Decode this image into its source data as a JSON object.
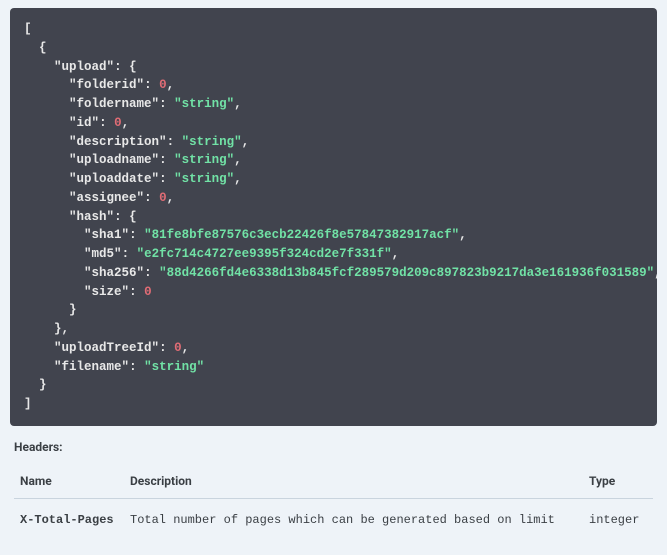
{
  "code": {
    "upload": {
      "folderid_key": "folderid",
      "folderid_val": "0",
      "foldername_key": "foldername",
      "foldername_val": "\"string\"",
      "id_key": "id",
      "id_val": "0",
      "description_key": "description",
      "description_val": "\"string\"",
      "uploadname_key": "uploadname",
      "uploadname_val": "\"string\"",
      "uploaddate_key": "uploaddate",
      "uploaddate_val": "\"string\"",
      "assignee_key": "assignee",
      "assignee_val": "0",
      "hash_key": "hash",
      "hash": {
        "sha1_key": "sha1",
        "sha1_val": "\"81fe8bfe87576c3ecb22426f8e57847382917acf\"",
        "md5_key": "md5",
        "md5_val": "\"e2fc714c4727ee9395f324cd2e7f331f\"",
        "sha256_key": "sha256",
        "sha256_val": "\"88d4266fd4e6338d13b845fcf289579d209c897823b9217da3e161936f031589\"",
        "size_key": "size",
        "size_val": "0"
      }
    },
    "uploadTreeId_key": "uploadTreeId",
    "uploadTreeId_val": "0",
    "filename_key": "filename",
    "filename_val": "\"string\"",
    "upload_key": "upload"
  },
  "headers_label": "Headers:",
  "headers_table": {
    "col_name": "Name",
    "col_desc": "Description",
    "col_type": "Type",
    "rows": [
      {
        "name": "X-Total-Pages",
        "description": "Total number of pages which can be generated based on limit",
        "type": "integer"
      }
    ]
  }
}
